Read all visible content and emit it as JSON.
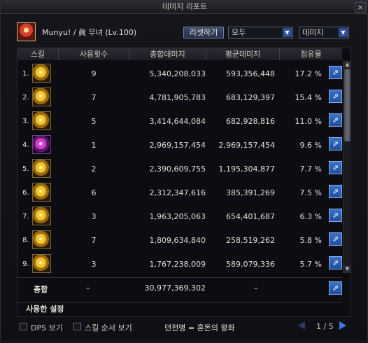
{
  "window": {
    "title": "데미지 리포트",
    "close_glyph": "×"
  },
  "character": {
    "name": "Munyu! / 眞 무녀 (Lv.100)"
  },
  "toolbar": {
    "reset_label": "리셋하기",
    "filter_select": "모두",
    "mode_select": "데미지",
    "dropdown_arrow": "▼"
  },
  "columns": {
    "skill": "스킬",
    "count": "사용횟수",
    "total": "총합데미지",
    "average": "평균데미지",
    "share": "점유율"
  },
  "rows": [
    {
      "rank": "1.",
      "count": "9",
      "total": "5,340,208,033",
      "average": "593,356,448",
      "share": "17.2 %",
      "icon": "skill-icon-gold"
    },
    {
      "rank": "2.",
      "count": "7",
      "total": "4,781,905,783",
      "average": "683,129,397",
      "share": "15.4 %",
      "icon": "skill-icon-gold"
    },
    {
      "rank": "3.",
      "count": "5",
      "total": "3,414,644,084",
      "average": "682,928,816",
      "share": "11.0 %",
      "icon": "skill-icon-gold"
    },
    {
      "rank": "4.",
      "count": "1",
      "total": "2,969,157,454",
      "average": "2,969,157,454",
      "share": "9.6 %",
      "icon": "skill-icon-purple"
    },
    {
      "rank": "5.",
      "count": "2",
      "total": "2,390,609,755",
      "average": "1,195,304,877",
      "share": "7.7 %",
      "icon": "skill-icon-gold"
    },
    {
      "rank": "6.",
      "count": "6",
      "total": "2,312,347,616",
      "average": "385,391,269",
      "share": "7.5 %",
      "icon": "skill-icon-gold"
    },
    {
      "rank": "7.",
      "count": "3",
      "total": "1,963,205,063",
      "average": "654,401,687",
      "share": "6.3 %",
      "icon": "skill-icon-gold"
    },
    {
      "rank": "8.",
      "count": "7",
      "total": "1,809,634,840",
      "average": "258,519,262",
      "share": "5.8 %",
      "icon": "skill-icon-gold"
    },
    {
      "rank": "9.",
      "count": "3",
      "total": "1,767,238,009",
      "average": "589,079,336",
      "share": "5.7 %",
      "icon": "skill-icon-gold"
    }
  ],
  "share_glyph": "⇗",
  "scroll": {
    "up": "▲",
    "down": "▼"
  },
  "total": {
    "label": "총합",
    "count": "–",
    "total": "30,977,369,302",
    "average": "–"
  },
  "used_setting": "사용한 설정",
  "footer": {
    "dps_label": "DPS 보기",
    "order_label": "스킬 순서 보기",
    "dungeon": "던전명 = 혼돈의 왕좌",
    "page": "1 / 5"
  }
}
